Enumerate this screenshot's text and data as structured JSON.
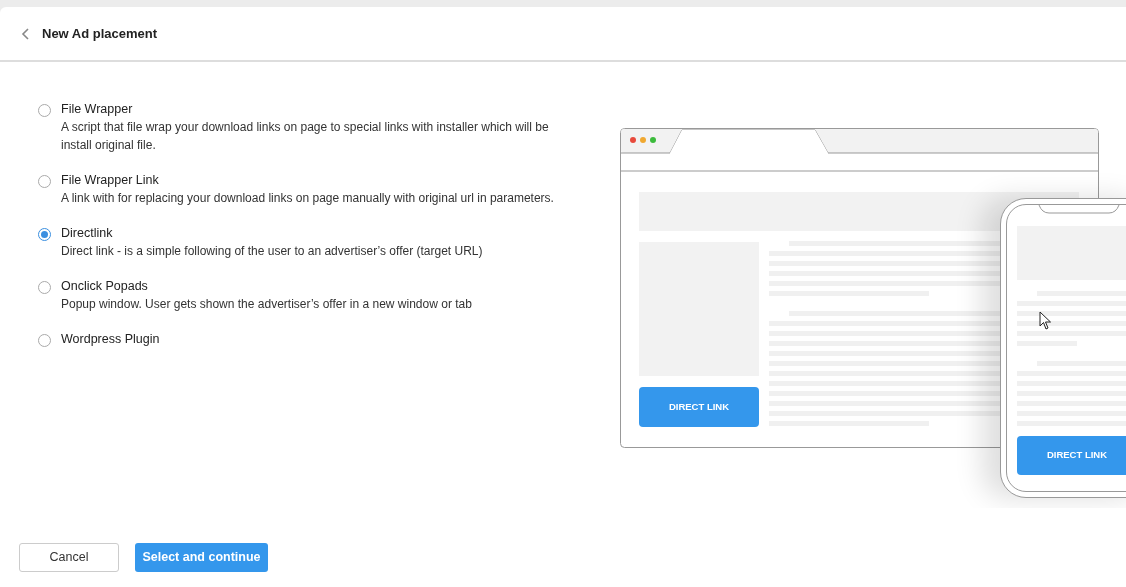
{
  "header": {
    "title": "New Ad placement"
  },
  "options": [
    {
      "title": "File Wrapper",
      "description": "A script that file wrap your download links on page to special links with installer which will be install original file.",
      "selected": false
    },
    {
      "title": "File Wrapper Link",
      "description": "A link with for replacing your download links on page manually with original url in parameters.",
      "selected": false
    },
    {
      "title": "Directlink",
      "description": "Direct link - is a simple following of the user to an advertiser’s offer (target URL)",
      "selected": true
    },
    {
      "title": "Onclick Popads",
      "description": "Popup window. User gets shown the advertiser’s offer in a new window or tab",
      "selected": false
    },
    {
      "title": "Wordpress Plugin",
      "selected": false
    }
  ],
  "illustration": {
    "desktop_button": "DIRECT LINK",
    "mobile_button": "DIRECT LINK"
  },
  "buttons": {
    "cancel": "Cancel",
    "submit": "Select and continue"
  }
}
